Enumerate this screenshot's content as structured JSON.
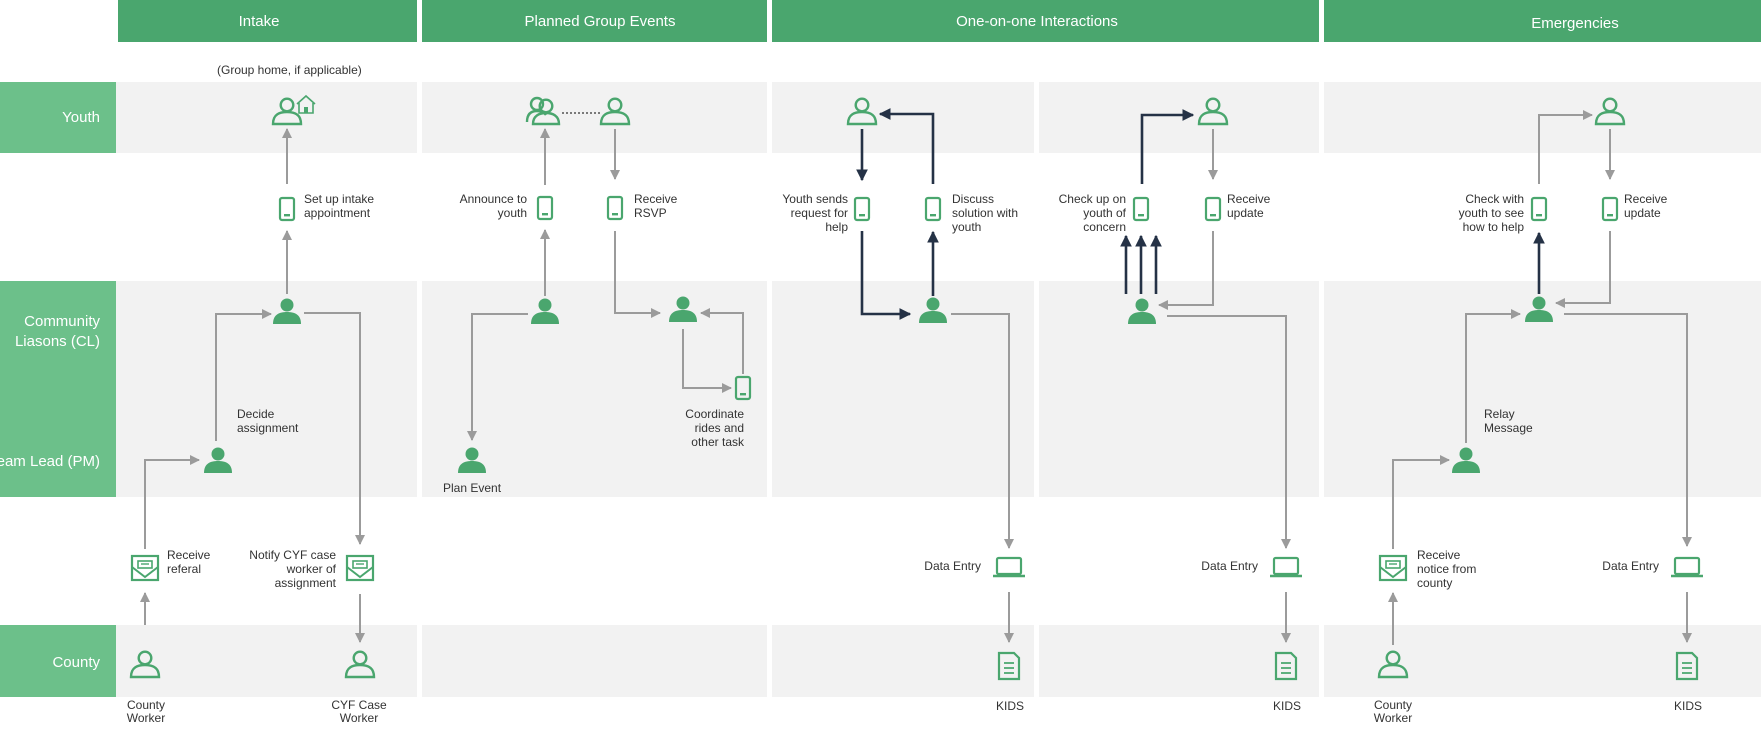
{
  "columns": [
    "Intake",
    "Planned Group Events",
    "One-on-one Interactions",
    "Emergencies"
  ],
  "lanes": {
    "youth": "Youth",
    "cl_line1": "Community",
    "cl_line2": "Liasons (CL)",
    "pm": "Team Lead (PM)",
    "county": "County"
  },
  "labels": {
    "group_home": "(Group home, if applicable)",
    "setup_1": "Set up intake",
    "setup_2": "appointment",
    "decide_1": "Decide",
    "decide_2": "assignment",
    "receive_referal_1": "Receive",
    "receive_referal_2": "referal",
    "notify_1": "Notify CYF case",
    "notify_2": "worker of",
    "notify_3": "assignment",
    "county_worker_1": "County",
    "county_worker_2": "Worker",
    "cyf_case_1": "CYF Case",
    "cyf_case_2": "Worker",
    "announce_1": "Announce to",
    "announce_2": "youth",
    "rsvp_1": "Receive",
    "rsvp_2": "RSVP",
    "coord_1": "Coordinate",
    "coord_2": "rides and",
    "coord_3": "other task",
    "plan_event": "Plan Event",
    "sends_1": "Youth sends",
    "sends_2": "request for",
    "sends_3": "help",
    "discuss_1": "Discuss",
    "discuss_2": "solution with",
    "discuss_3": "youth",
    "checkup_1": "Check up on",
    "checkup_2": "youth of",
    "checkup_3": "concern",
    "recv_update_1": "Receive",
    "recv_update_2": "update",
    "data_entry": "Data Entry",
    "kids": "KIDS",
    "checkwith_1": "Check with",
    "checkwith_2": "youth to see",
    "checkwith_3": "how to help",
    "relay_1": "Relay",
    "relay_2": "Message",
    "notice_1": "Receive",
    "notice_2": "notice from",
    "notice_3": "county"
  },
  "colors": {
    "header": "#4aa66e",
    "lane": "#6cc08a",
    "band": "#f2f2f2",
    "arrow": "#9b9b9b",
    "arrow_emphasis": "#253246"
  },
  "icons": [
    "person-icon",
    "person-outline-icon",
    "group-icon",
    "house-icon",
    "phone-icon",
    "envelope-icon",
    "laptop-icon",
    "document-icon"
  ]
}
